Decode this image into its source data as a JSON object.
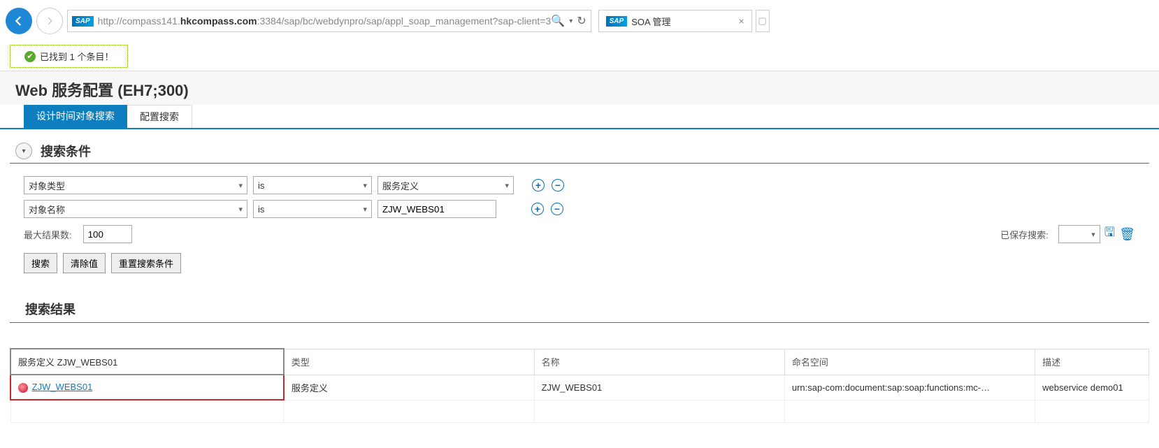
{
  "browser": {
    "url_prefix": "http://compass141.",
    "url_bold": "hkcompass.com",
    "url_suffix": ":3384/sap/bc/webdynpro/sap/appl_soap_management?sap-client=3",
    "tab_title": "SOA 管理"
  },
  "status": {
    "text": "已找到 1 个条目！"
  },
  "page_title": "Web 服务配置 (EH7;300)",
  "tabs": {
    "t1": "设计时间对象搜索",
    "t2": "配置搜索"
  },
  "section1": "搜索条件",
  "crit": {
    "rows": [
      {
        "field": "对象类型",
        "op": "is",
        "value": "服务定义",
        "vtype": "select"
      },
      {
        "field": "对象名称",
        "op": "is",
        "value": "ZJW_WEBS01",
        "vtype": "input"
      }
    ],
    "max_label": "最大结果数:",
    "max_value": "100",
    "btn_search": "搜索",
    "btn_clear": "清除值",
    "btn_reset": "重置搜索条件",
    "saved_label": "已保存搜索:",
    "saved_value": ""
  },
  "section2": "搜索结果",
  "table": {
    "headers": {
      "h0": "服务定义 ZJW_WEBS01",
      "h1": "类型",
      "h2": "名称",
      "h3": "命名空间",
      "h4": "描述"
    },
    "row": {
      "link": " ZJW_WEBS01",
      "type": "服务定义",
      "name": "ZJW_WEBS01",
      "ns": "urn:sap-com:document:sap:soap:functions:mc-…",
      "desc": "webservice demo01"
    }
  }
}
